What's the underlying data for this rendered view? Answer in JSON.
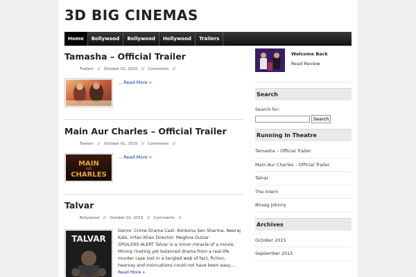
{
  "site": {
    "title": "3D BIG CINEMAS"
  },
  "nav": {
    "items": [
      "Home",
      "Bollywood",
      "Bollywood",
      "Hollywood",
      "Trailers"
    ]
  },
  "posts": [
    {
      "title": "Tamasha – Official Trailer",
      "category": "Trailers",
      "date": "October 01, 2015",
      "comments": "Comments",
      "excerpt": "",
      "more_prefix": "...",
      "more": "Read More »"
    },
    {
      "title": "Main Aur Charles – Official Trailer",
      "category": "Trailers",
      "date": "October 01, 2015",
      "comments": "Comments",
      "excerpt": "",
      "more_prefix": "...",
      "more": "Read More »",
      "poster_text_1": "MAIN",
      "poster_text_2": "CHARLES",
      "poster_text_small": "AUR"
    },
    {
      "title": "Talvar",
      "category": "Bollywood",
      "date": "October 01, 2015",
      "comments": "Comments",
      "excerpt": "Genre: Crime Drama Cast: Konkona Sen Sharma, Neeraj Kabi, Irrfan Khan Director: Meghna Gulzar          SPOILERS ALERT Talvar is a minor miracle of a movie. Mining riveting yet balanced drama from a real-life murder case lost in a tangled web of fact, fiction, hearsay and insinuations could not have been easy....",
      "more_prefix": "",
      "more": "Read More »",
      "poster_text_1": "TALVAR"
    }
  ],
  "meta_sep": "//",
  "sidebar": {
    "welcome": {
      "title": "Welcome Back",
      "link": "Read Review"
    },
    "search": {
      "heading": "Search",
      "label": "Search for:",
      "button": "Search",
      "value": ""
    },
    "running": {
      "heading": "Running In Theatre",
      "items": [
        "Tamasha – Official Trailer",
        "Main Aur Charles – Official Trailer",
        "Talvar",
        "The Intern",
        "Bhaag Johnny"
      ]
    },
    "archives": {
      "heading": "Archives",
      "items": [
        "October 2015",
        "September 2015"
      ]
    }
  }
}
